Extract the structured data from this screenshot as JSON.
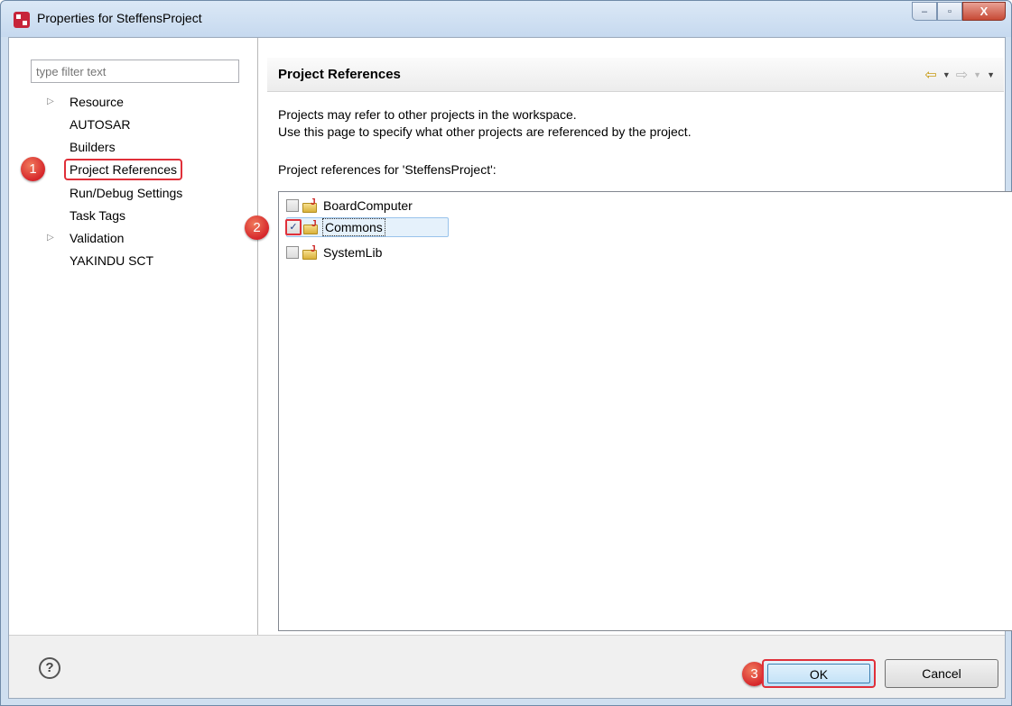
{
  "window": {
    "title": "Properties for SteffensProject",
    "minimize_glyph": "–",
    "maximize_glyph": "▫",
    "close_glyph": "X"
  },
  "sidebar": {
    "filter_placeholder": "type filter text",
    "items": [
      {
        "label": "Resource",
        "expandable": true
      },
      {
        "label": "AUTOSAR",
        "expandable": false
      },
      {
        "label": "Builders",
        "expandable": false
      },
      {
        "label": "Project References",
        "expandable": false,
        "selected": true
      },
      {
        "label": "Run/Debug Settings",
        "expandable": false
      },
      {
        "label": "Task Tags",
        "expandable": false
      },
      {
        "label": "Validation",
        "expandable": true
      },
      {
        "label": "YAKINDU SCT",
        "expandable": false
      }
    ]
  },
  "page": {
    "title": "Project References",
    "description_line1": "Projects may refer to other projects in the workspace.",
    "description_line2": "Use this page to specify what other projects are referenced by the project.",
    "refs_label": "Project references for 'SteffensProject':",
    "references": [
      {
        "name": "BoardComputer",
        "checked": false
      },
      {
        "name": "Commons",
        "checked": true,
        "selected": true
      },
      {
        "name": "SystemLib",
        "checked": false
      }
    ]
  },
  "footer": {
    "help_glyph": "?",
    "ok_label": "OK",
    "cancel_label": "Cancel"
  },
  "annotations": {
    "marker1": "1",
    "marker2": "2",
    "marker3": "3"
  },
  "colors": {
    "highlight_red": "#e0303a",
    "nav_arrow": "#c79b15"
  }
}
